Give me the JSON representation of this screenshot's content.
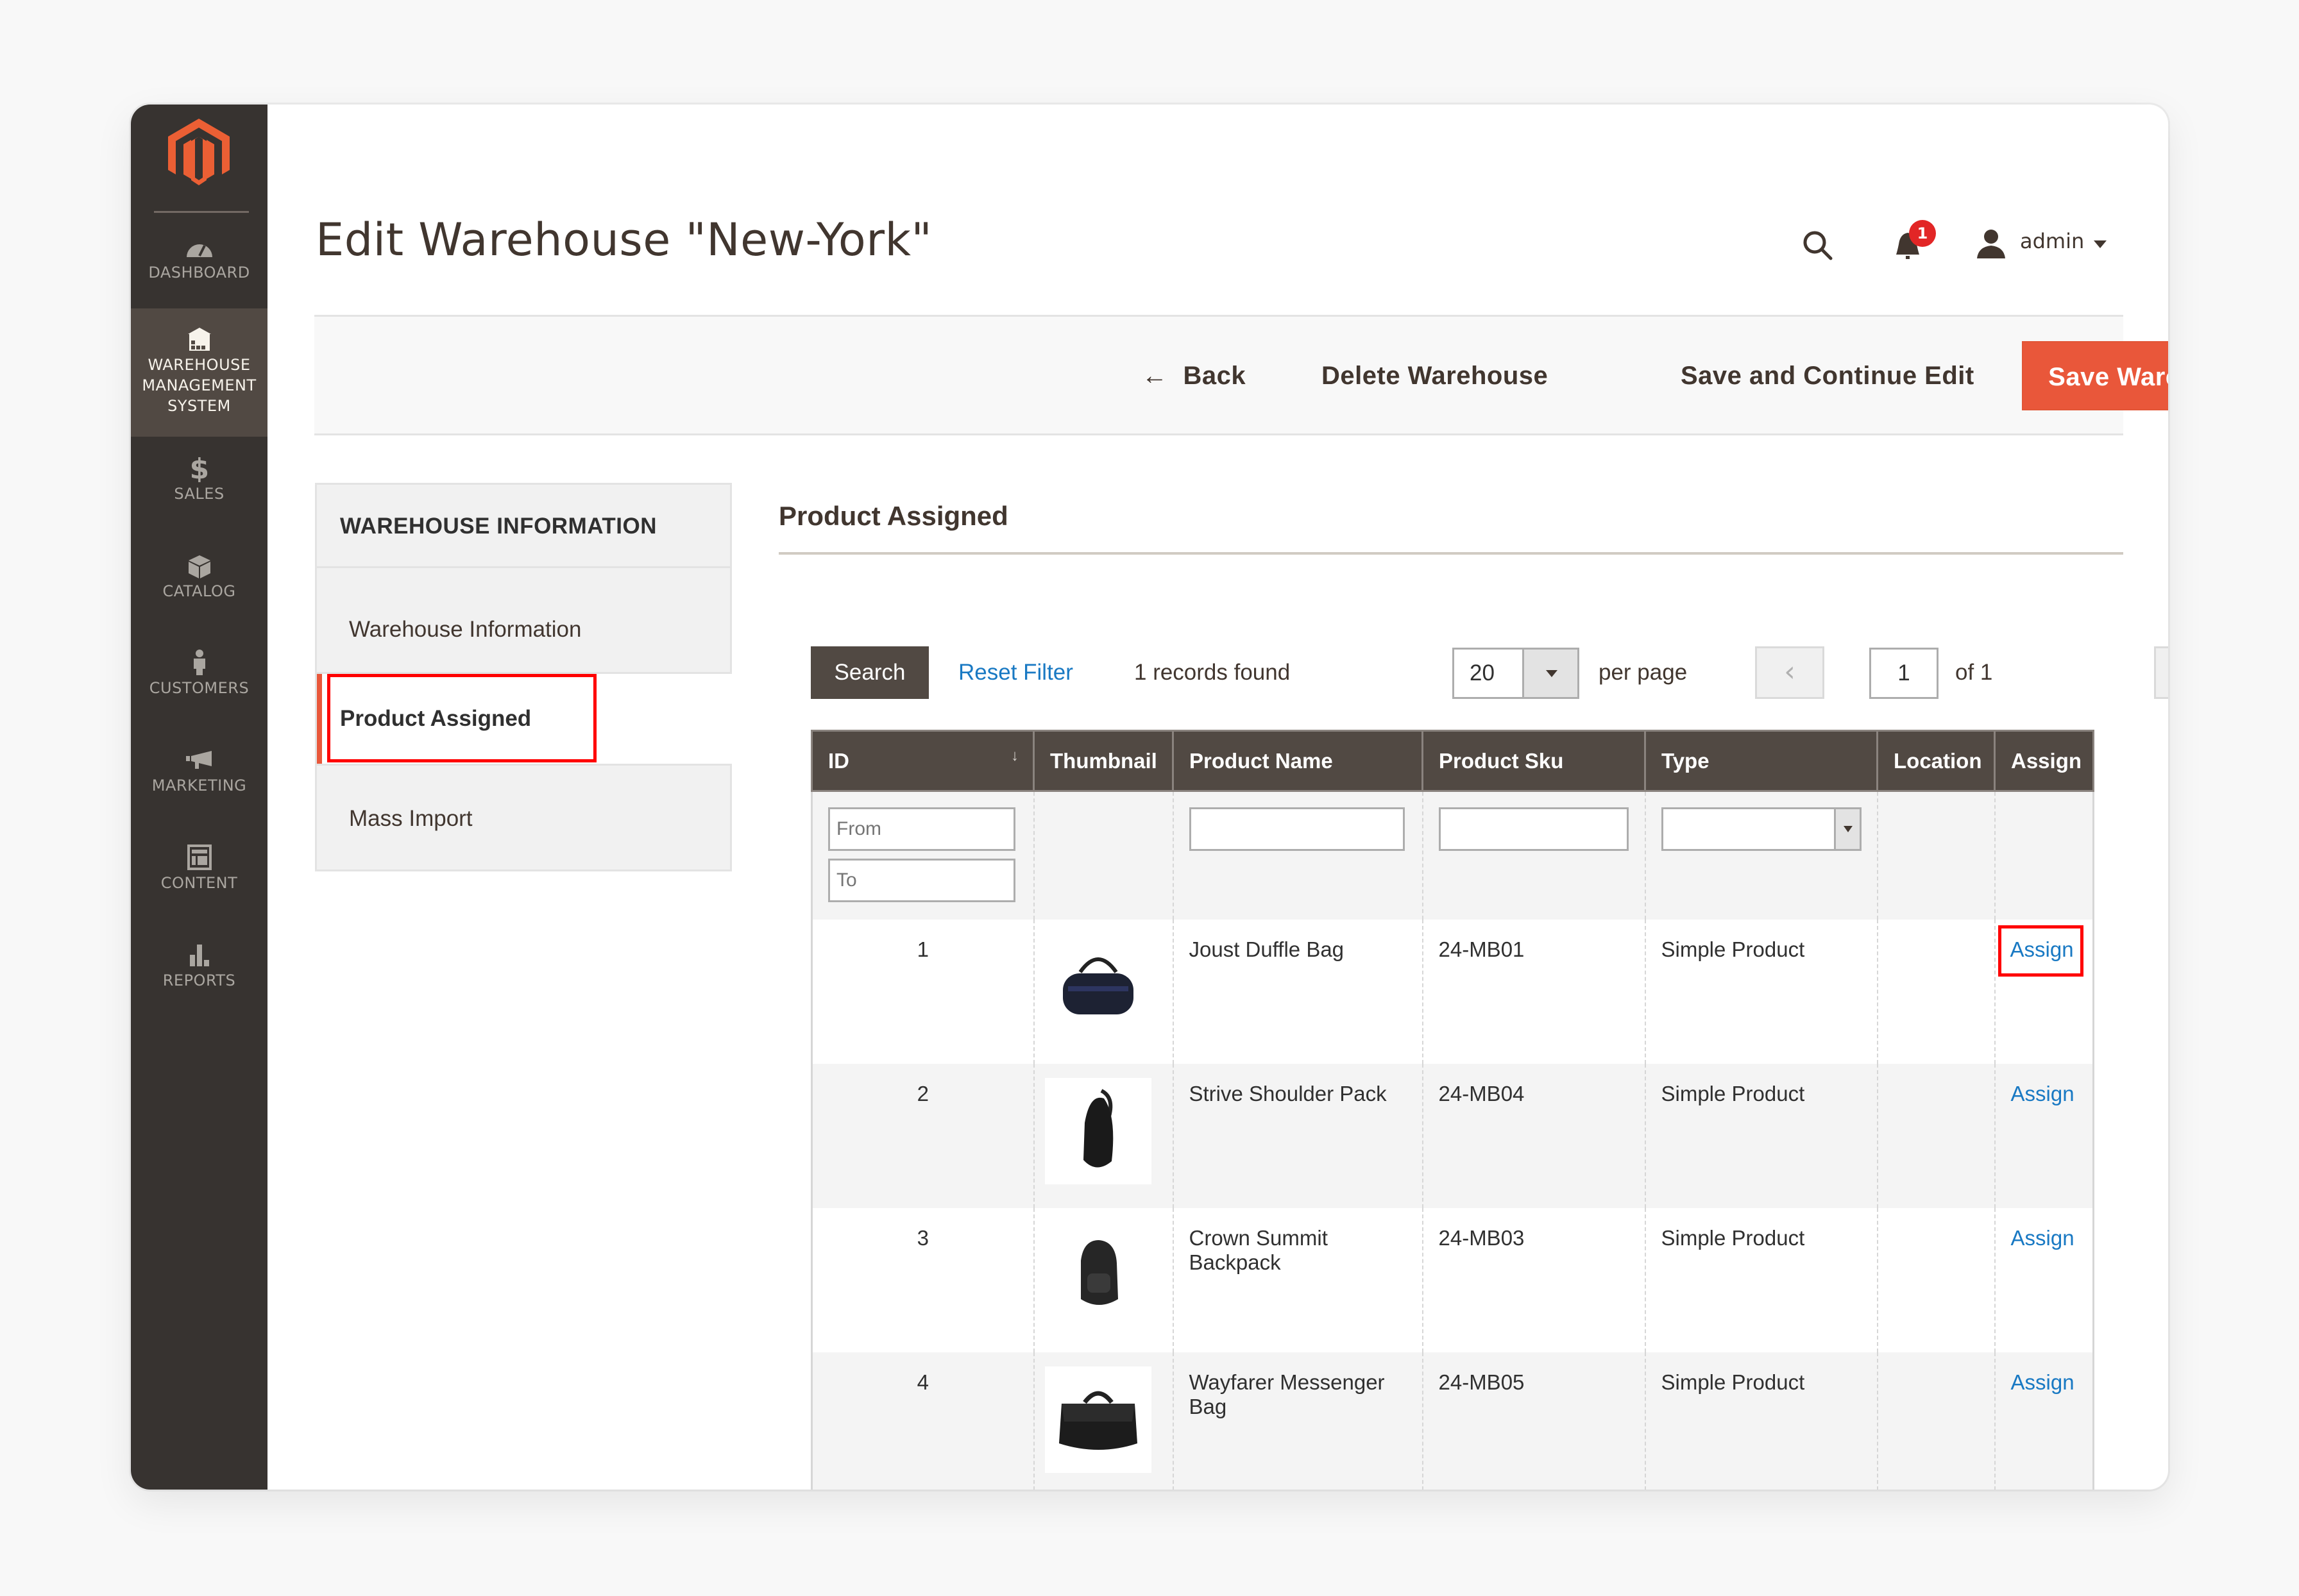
{
  "sidebar": {
    "logo": "magento-logo",
    "items": [
      {
        "label": "DASHBOARD",
        "icon": "dashboard-gauge-icon",
        "active": false
      },
      {
        "label": "WAREHOUSE MANAGEMENT SYSTEM",
        "line1": "WAREHOUSE",
        "line2": "MANAGEMENT",
        "line3": "SYSTEM",
        "icon": "warehouse-icon",
        "active": true
      },
      {
        "label": "SALES",
        "icon": "dollar-icon",
        "active": false
      },
      {
        "label": "CATALOG",
        "icon": "box-icon",
        "active": false
      },
      {
        "label": "CUSTOMERS",
        "icon": "person-icon",
        "active": false
      },
      {
        "label": "MARKETING",
        "icon": "megaphone-icon",
        "active": false
      },
      {
        "label": "CONTENT",
        "icon": "layout-icon",
        "active": false
      },
      {
        "label": "REPORTS",
        "icon": "bar-chart-icon",
        "active": false
      }
    ]
  },
  "header": {
    "title": "Edit Warehouse \"New-York\"",
    "notification_count": "1",
    "user": "admin"
  },
  "actions": {
    "back": "Back",
    "delete": "Delete Warehouse",
    "save_continue": "Save and Continue Edit",
    "save": "Save Warehouse"
  },
  "tabs": {
    "title": "WAREHOUSE INFORMATION",
    "items": [
      {
        "label": "Warehouse Information",
        "active": false
      },
      {
        "label": "Product Assigned",
        "active": true
      },
      {
        "label": "Mass Import",
        "active": false
      }
    ]
  },
  "content": {
    "section_title": "Product Assigned",
    "toolbar": {
      "search": "Search",
      "reset": "Reset Filter",
      "records": "1 records found",
      "per_page_value": "20",
      "per_page_label": "per page",
      "page": "1",
      "of": "of 1"
    },
    "grid": {
      "columns": [
        "ID",
        "Thumbnail",
        "Product Name",
        "Product Sku",
        "Type",
        "Location",
        "Assign"
      ],
      "sort_indicator": "↓",
      "filters": {
        "id_from_placeholder": "From",
        "id_to_placeholder": "To",
        "name_value": "",
        "sku_value": "",
        "type_value": ""
      },
      "rows": [
        {
          "id": "1",
          "thumbnail": "duffle-bag",
          "name": "Joust Duffle Bag",
          "sku": "24-MB01",
          "type": "Simple Product",
          "location": "",
          "assign": "Assign"
        },
        {
          "id": "2",
          "thumbnail": "shoulder-pack",
          "name": "Strive Shoulder Pack",
          "sku": "24-MB04",
          "type": "Simple Product",
          "location": "",
          "assign": "Assign"
        },
        {
          "id": "3",
          "thumbnail": "backpack",
          "name": "Crown Summit Backpack",
          "sku": "24-MB03",
          "type": "Simple Product",
          "location": "",
          "assign": "Assign"
        },
        {
          "id": "4",
          "thumbnail": "messenger-bag",
          "name": "Wayfarer Messenger Bag",
          "sku": "24-MB05",
          "type": "Simple Product",
          "location": "",
          "assign": "Assign"
        }
      ]
    }
  },
  "colors": {
    "brand": "#e9573a",
    "sidebar": "#373330",
    "sidebar_active": "#514943",
    "grid_header": "#514943",
    "link": "#1979c3",
    "highlight": "#ff0000"
  }
}
